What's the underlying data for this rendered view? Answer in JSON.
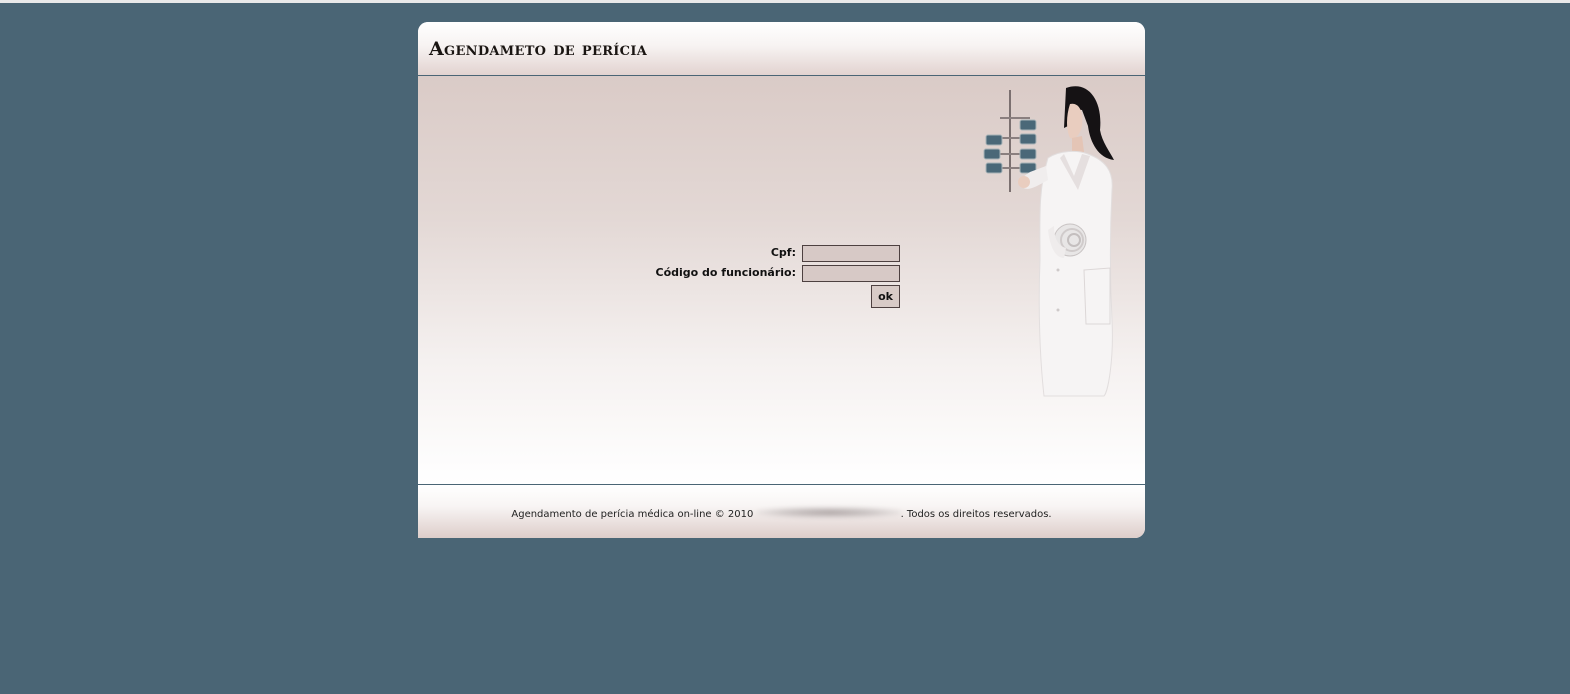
{
  "header": {
    "title": "Agendameto de perícia"
  },
  "form": {
    "cpf_label": "Cpf:",
    "cpf_value": "",
    "employee_code_label": "Código do funcionário:",
    "employee_code_value": "",
    "submit_label": "ok"
  },
  "footer": {
    "copyright_prefix": "Agendamento de perícia médica on-line © 2010",
    "copyright_suffix": ". Todos os direitos reservados."
  },
  "colors": {
    "page_background": "#4a6575",
    "panel_tint": "#dacbc7",
    "input_background": "#d7c9c6"
  },
  "icons": {
    "illustration": "doctor-with-xray-illustration"
  }
}
